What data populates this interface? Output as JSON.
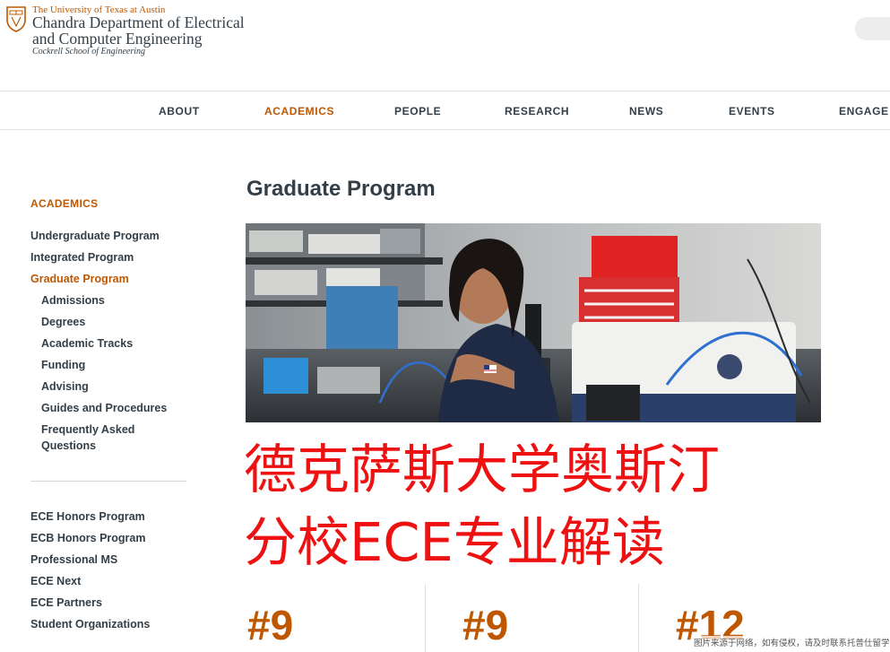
{
  "header": {
    "university": "The University of Texas at Austin",
    "department_line1": "Chandra Department of Electrical",
    "department_line2": "and Computer Engineering",
    "school": "Cockrell School of Engineering"
  },
  "nav": {
    "items": [
      {
        "label": "ABOUT",
        "active": false
      },
      {
        "label": "ACADEMICS",
        "active": true
      },
      {
        "label": "PEOPLE",
        "active": false
      },
      {
        "label": "RESEARCH",
        "active": false
      },
      {
        "label": "NEWS",
        "active": false
      },
      {
        "label": "EVENTS",
        "active": false
      },
      {
        "label": "ENGAGE",
        "active": false
      }
    ]
  },
  "sidebar": {
    "heading": "ACADEMICS",
    "items": [
      {
        "label": "Undergraduate Program"
      },
      {
        "label": "Integrated Program"
      },
      {
        "label": "Graduate Program"
      },
      {
        "label": "Admissions"
      },
      {
        "label": "Degrees"
      },
      {
        "label": "Academic Tracks"
      },
      {
        "label": "Funding"
      },
      {
        "label": "Advising"
      },
      {
        "label": "Guides and Procedures"
      },
      {
        "label": "Frequently Asked Questions"
      }
    ],
    "secondary": [
      {
        "label": "ECE Honors Program"
      },
      {
        "label": "ECB Honors Program"
      },
      {
        "label": "Professional MS"
      },
      {
        "label": "ECE Next"
      },
      {
        "label": "ECE Partners"
      },
      {
        "label": "Student Organizations"
      }
    ]
  },
  "main": {
    "title": "Graduate Program",
    "overlay_line1": "德克萨斯大学奥斯汀",
    "overlay_line2": "分校ECE专业解读",
    "stats": [
      "#9",
      "#9",
      "#12"
    ],
    "watermark": "图片来源于网络，如有侵权，请及时联系托普仕留学删除"
  },
  "colors": {
    "burnt_orange": "#bf5700",
    "charcoal": "#333f48",
    "overlay_red": "#ee1111"
  }
}
